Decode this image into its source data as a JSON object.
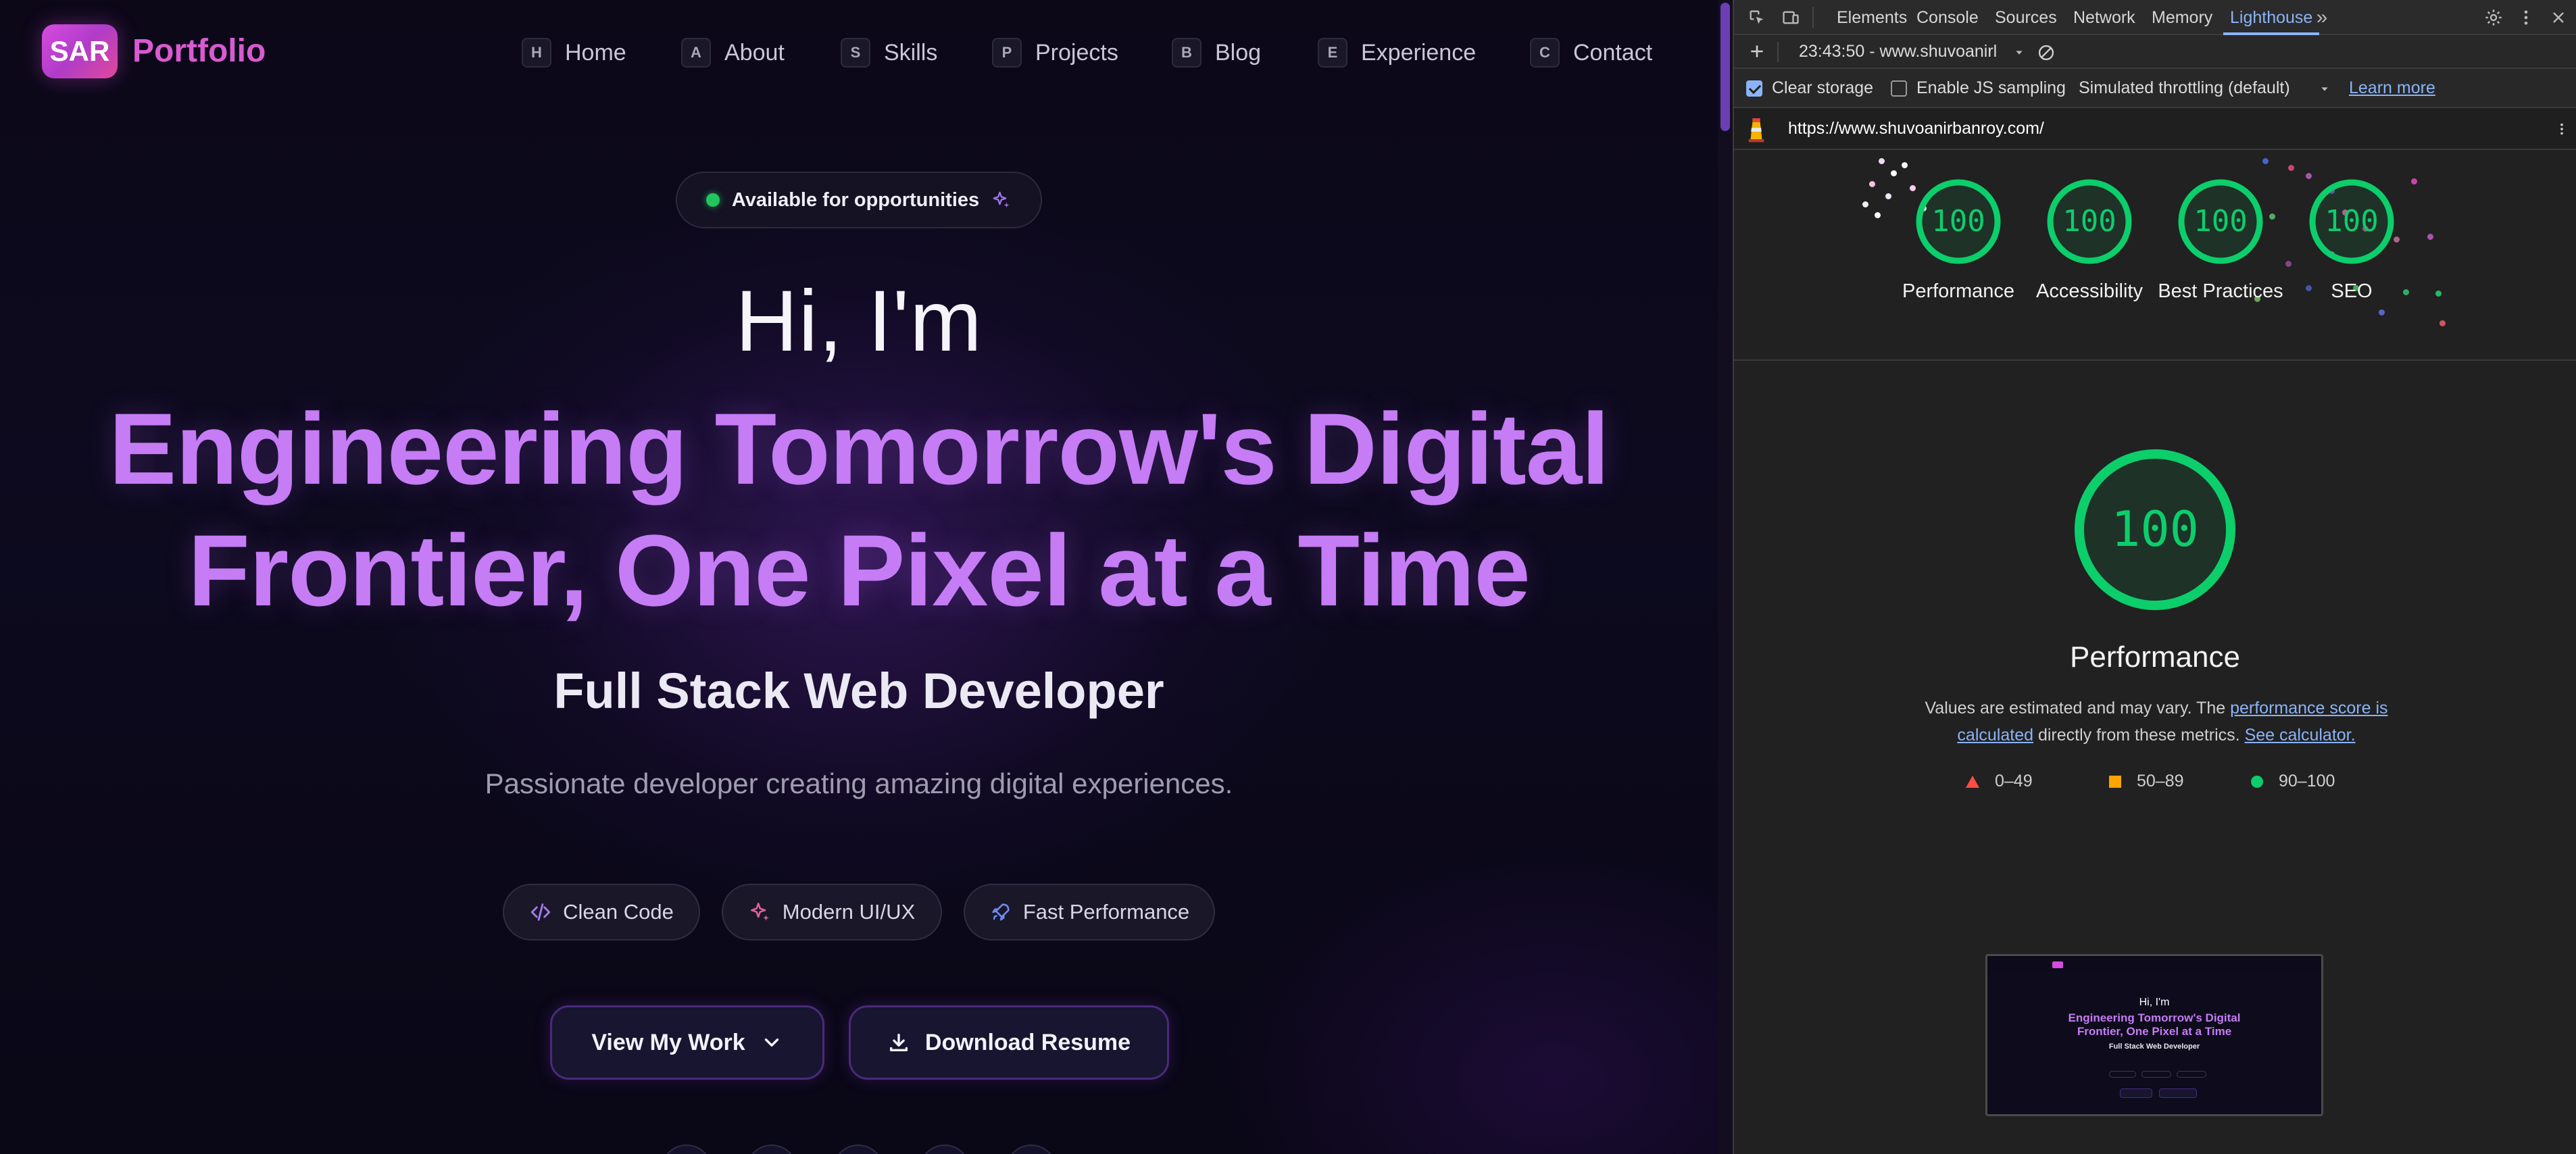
{
  "site": {
    "logo_badge": "SAR",
    "logo_text": "Portfolio",
    "nav": [
      {
        "key": "H",
        "label": "Home"
      },
      {
        "key": "A",
        "label": "About"
      },
      {
        "key": "S",
        "label": "Skills"
      },
      {
        "key": "P",
        "label": "Projects"
      },
      {
        "key": "B",
        "label": "Blog"
      },
      {
        "key": "E",
        "label": "Experience"
      },
      {
        "key": "C",
        "label": "Contact"
      }
    ],
    "availability": "Available for opportunities",
    "greeting": "Hi, I'm",
    "headline_line1": "Engineering Tomorrow's Digital",
    "headline_line2": "Frontier, One Pixel at a Time",
    "role": "Full Stack Web Developer",
    "tagline": "Passionate developer creating amazing digital experiences.",
    "pills": [
      "Clean Code",
      "Modern UI/UX",
      "Fast Performance"
    ],
    "buttons": {
      "primary": "View My Work",
      "secondary": "Download Resume"
    },
    "colors": {
      "accent": "#c57cf4",
      "logo": "#d85ad0",
      "status": "#22c55e"
    }
  },
  "devtools": {
    "tabs": [
      "Elements",
      "Console",
      "Sources",
      "Network",
      "Memory",
      "Lighthouse"
    ],
    "active_tab": "Lighthouse",
    "report_selector": "23:43:50 - www.shuvoanirl",
    "clear_storage": "Clear storage",
    "clear_storage_checked": true,
    "js_sampling": "Enable JS sampling",
    "js_sampling_checked": false,
    "throttling": "Simulated throttling (default)",
    "learn_more": "Learn more",
    "url": "https://www.shuvoanirbanroy.com/",
    "scores": [
      {
        "label": "Performance",
        "value": "100"
      },
      {
        "label": "Accessibility",
        "value": "100"
      },
      {
        "label": "Best Practices",
        "value": "100"
      },
      {
        "label": "SEO",
        "value": "100"
      }
    ],
    "main_score": "100",
    "main_title": "Performance",
    "desc_prefix": "Values are estimated and may vary. The ",
    "desc_link1": "performance score is calculated",
    "desc_mid": " directly from these metrics. ",
    "desc_link2": "See calculator.",
    "legend": [
      {
        "range": "0–49",
        "color": "#ff4e42"
      },
      {
        "range": "50–89",
        "color": "#ffa400"
      },
      {
        "range": "90–100",
        "color": "#0cce6b"
      }
    ],
    "score_color": "#0cce6b"
  }
}
